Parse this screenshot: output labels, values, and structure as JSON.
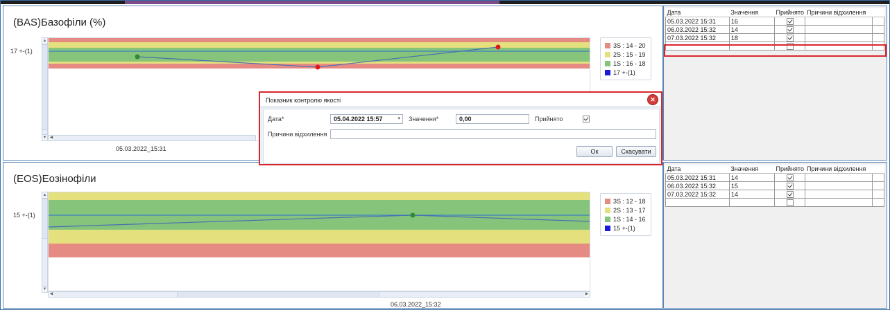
{
  "panels": [
    {
      "title": "(BAS)Базофіли (%)",
      "ytick": "17 +-(1)",
      "xtick": "05.03.2022_15:31",
      "legend": [
        {
          "label": "3S : 14 - 20",
          "color": "#e68a84"
        },
        {
          "label": "2S : 15 - 19",
          "color": "#e4e07e"
        },
        {
          "label": "1S : 16 - 18",
          "color": "#86c47c"
        },
        {
          "label": "17 +-(1)",
          "color": "#1a1adb"
        }
      ]
    },
    {
      "title": "(EOS)Еозінофіли",
      "ytick": "15 +-(1)",
      "xtick": "06.03.2022_15:32",
      "legend": [
        {
          "label": "3S : 12 - 18",
          "color": "#e68a84"
        },
        {
          "label": "2S : 13 - 17",
          "color": "#e4e07e"
        },
        {
          "label": "1S : 14 - 16",
          "color": "#86c47c"
        },
        {
          "label": "15 +-(1)",
          "color": "#1a1adb"
        }
      ]
    }
  ],
  "tables": [
    {
      "headers": [
        "Дата",
        "Значення",
        "Прийнято",
        "Причини відхилення"
      ],
      "rows": [
        {
          "date": "05.03.2022 15:31",
          "value": "16",
          "accepted": true
        },
        {
          "date": "06.03.2022 15:32",
          "value": "14",
          "accepted": true
        },
        {
          "date": "07.03.2022 15:32",
          "value": "18",
          "accepted": true
        },
        {
          "date": "",
          "value": "",
          "accepted": false
        }
      ]
    },
    {
      "headers": [
        "Дата",
        "Значення",
        "Прийнято",
        "Причини відхилення"
      ],
      "rows": [
        {
          "date": "05.03.2022 15:31",
          "value": "14",
          "accepted": true
        },
        {
          "date": "06.03.2022 15:32",
          "value": "15",
          "accepted": true
        },
        {
          "date": "07.03.2022 15:32",
          "value": "14",
          "accepted": true
        },
        {
          "date": "",
          "value": "",
          "accepted": false
        }
      ]
    }
  ],
  "dialog": {
    "title": "Показник контролю якості",
    "date_label": "Дата*",
    "date_value": "05.04.2022 15:57",
    "value_label": "Значення*",
    "value_value": "0,00",
    "accepted_label": "Прийнято",
    "reason_label": "Причини відхилення",
    "reason_value": "",
    "ok_label": "Ок",
    "cancel_label": "Скасувати"
  }
}
